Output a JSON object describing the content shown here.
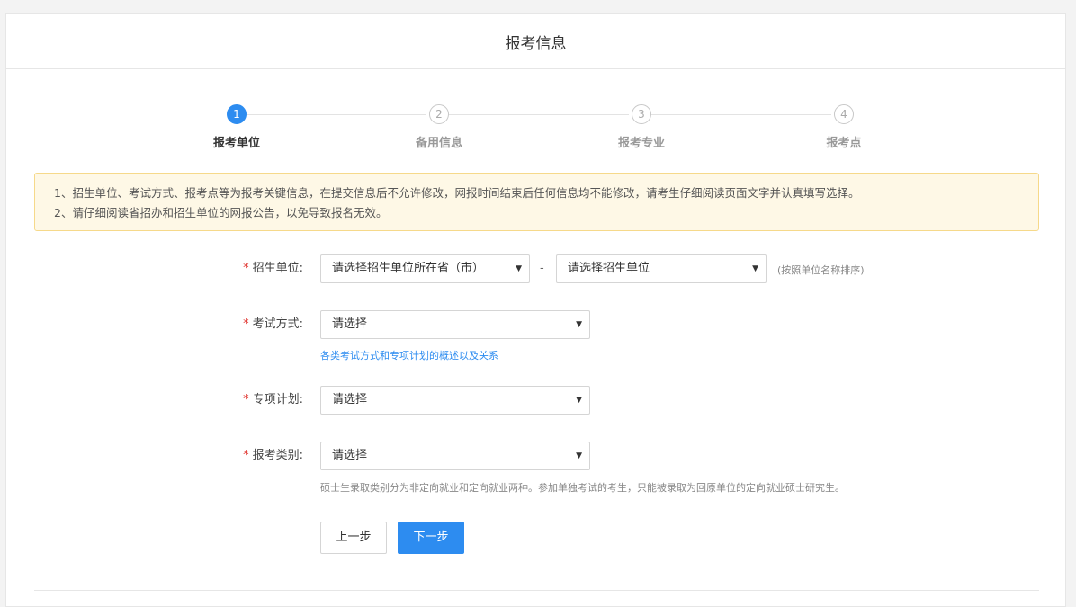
{
  "header": {
    "title": "报考信息"
  },
  "steps": [
    {
      "number": "1",
      "label": "报考单位",
      "active": true
    },
    {
      "number": "2",
      "label": "备用信息",
      "active": false
    },
    {
      "number": "3",
      "label": "报考专业",
      "active": false
    },
    {
      "number": "4",
      "label": "报考点",
      "active": false
    }
  ],
  "notice": {
    "line1": "1、招生单位、考试方式、报考点等为报考关键信息，在提交信息后不允许修改，网报时间结束后任何信息均不能修改，请考生仔细阅读页面文字并认真填写选择。",
    "line2": "2、请仔细阅读省招办和招生单位的网报公告，以免导致报名无效。"
  },
  "form": {
    "required_mark": "*",
    "unit": {
      "label": "招生单位:",
      "province_select": "请选择招生单位所在省（市）",
      "separator": "-",
      "unit_select": "请选择招生单位",
      "hint": "(按照单位名称排序)"
    },
    "exam_mode": {
      "label": "考试方式:",
      "select": "请选择",
      "link": "各类考试方式和专项计划的概述以及关系"
    },
    "special_plan": {
      "label": "专项计划:",
      "select": "请选择"
    },
    "category": {
      "label": "报考类别:",
      "select": "请选择",
      "hint": "硕士生录取类别分为非定向就业和定向就业两种。参加单独考试的考生，只能被录取为回原单位的定向就业硕士研究生。"
    }
  },
  "buttons": {
    "prev": "上一步",
    "next": "下一步"
  },
  "icons": {
    "dropdown": "chevron-down-icon"
  },
  "colors": {
    "accent": "#2d8cf0",
    "required": "#e0302b",
    "notice_bg": "#fef8e6",
    "notice_border": "#f6d98a"
  }
}
